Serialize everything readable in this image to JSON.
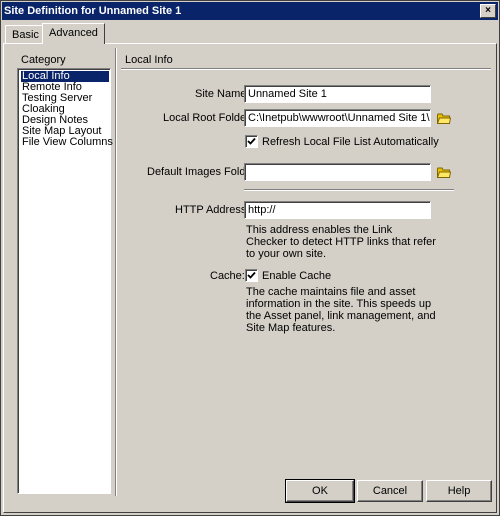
{
  "window": {
    "title": "Site Definition for Unnamed Site 1",
    "close_glyph": "×"
  },
  "tabs": [
    {
      "label": "Basic"
    },
    {
      "label": "Advanced"
    }
  ],
  "category": {
    "heading": "Category",
    "selected": "Local Info",
    "items": [
      {
        "label": "Local Info"
      },
      {
        "label": "Remote Info"
      },
      {
        "label": "Testing Server"
      },
      {
        "label": "Cloaking"
      },
      {
        "label": "Design Notes"
      },
      {
        "label": "Site Map Layout"
      },
      {
        "label": "File View Columns"
      }
    ]
  },
  "local_info": {
    "heading": "Local Info",
    "site_name_label": "Site Name:",
    "site_name_value": "Unnamed Site 1",
    "local_root_label": "Local Root Folder:",
    "local_root_value": "C:\\Inetpub\\wwwroot\\Unnamed Site 1\\",
    "refresh_label": "Refresh Local File List Automatically",
    "refresh_checked": true,
    "default_images_label": "Default Images Folder:",
    "default_images_value": "",
    "http_label": "HTTP Address:",
    "http_value": "http://",
    "http_help": "This address enables the Link Checker to detect HTTP links that refer to your own site.",
    "cache_label": "Cache:",
    "enable_cache_label": "Enable Cache",
    "enable_cache_checked": true,
    "cache_help": "The cache maintains file and asset information in the site.  This speeds up the Asset panel, link management, and Site Map features."
  },
  "buttons": {
    "ok": "OK",
    "cancel": "Cancel",
    "help": "Help"
  },
  "icons": {
    "folder": "folder-icon",
    "check": "checkmark-icon",
    "close": "close-icon"
  }
}
